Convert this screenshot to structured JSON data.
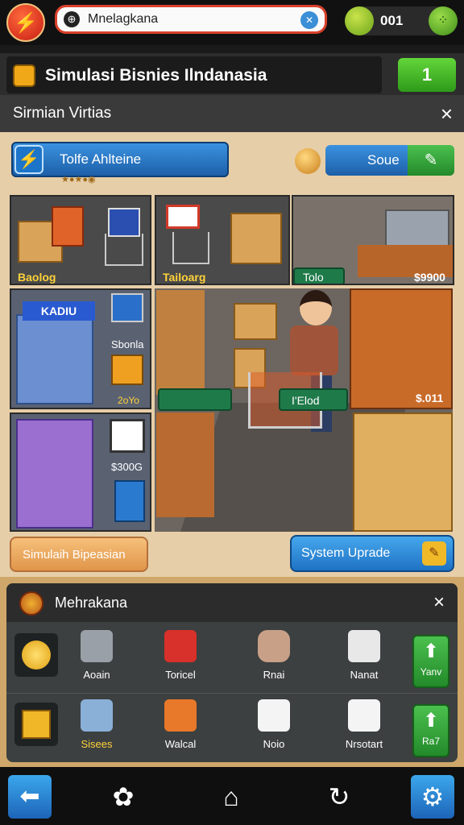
{
  "top": {
    "search_text": "Mnelagkana",
    "coins": "001"
  },
  "header": {
    "title": "Simulasi Bisnies Ilndanasia",
    "level": "1",
    "subtitle": "Sirmian Virtias",
    "close": "×"
  },
  "main": {
    "fast_button": "Tolfe Ahlteine",
    "save_button": "Soue",
    "tiles": {
      "t1": "Baolog",
      "t2": "Tailoarg",
      "t3_pill": "Tolo",
      "t3_price": "$9900",
      "t4_label": "Sbonla",
      "t4_price": "2oYo",
      "t4_sign": "KADIU",
      "center_pill": "I'Elod",
      "right_price": "$.011",
      "t7_price": "$300G"
    },
    "sim_button": "Simulaih Bipeasian",
    "system_button": "System Uprade"
  },
  "bottom": {
    "title": "Mehrakana",
    "close": "×",
    "row1": [
      {
        "label": "Aoain"
      },
      {
        "label": "Toricel"
      },
      {
        "label": "Rnai"
      },
      {
        "label": "Nanat"
      }
    ],
    "row1_go": "Yanv",
    "row2_lead": "Sisees",
    "row2": [
      {
        "label": "Walcal"
      },
      {
        "label": "Noio"
      },
      {
        "label": "Nrsotart"
      }
    ],
    "row2_go": "Ra7"
  },
  "colors": {
    "accent_blue": "#1f72c4",
    "accent_green": "#2e9a1a",
    "panel_tan": "#e6cea8"
  }
}
